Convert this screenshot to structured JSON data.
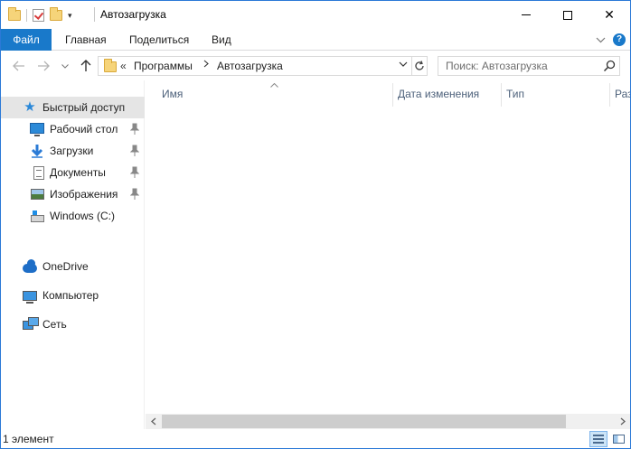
{
  "window": {
    "title": "Автозагрузка",
    "minimize_glyph": "",
    "maximize_glyph": "",
    "close_glyph": "✕"
  },
  "ribbon": {
    "tabs": [
      {
        "label": "Файл"
      },
      {
        "label": "Главная"
      },
      {
        "label": "Поделиться"
      },
      {
        "label": "Вид"
      }
    ],
    "help_glyph": "?"
  },
  "navigation": {
    "overflow_glyph": "«",
    "breadcrumbs": [
      "Программы",
      "Автозагрузка"
    ]
  },
  "search": {
    "placeholder": "Поиск: Автозагрузка"
  },
  "sidebar": {
    "quick_access": {
      "label": "Быстрый доступ",
      "icon": "star-icon"
    },
    "pinned": [
      {
        "label": "Рабочий стол",
        "icon": "desktop-icon",
        "pinned": true
      },
      {
        "label": "Загрузки",
        "icon": "download-icon",
        "pinned": true
      },
      {
        "label": "Документы",
        "icon": "documents-icon",
        "pinned": true
      },
      {
        "label": "Изображения",
        "icon": "pictures-icon",
        "pinned": true
      },
      {
        "label": "Windows (C:)",
        "icon": "drive-icon",
        "pinned": false
      }
    ],
    "locations": [
      {
        "label": "OneDrive",
        "icon": "onedrive-icon"
      },
      {
        "label": "Компьютер",
        "icon": "computer-icon"
      },
      {
        "label": "Сеть",
        "icon": "network-icon"
      }
    ]
  },
  "file_list": {
    "columns": [
      {
        "label": "Имя",
        "sorted": true
      },
      {
        "label": "Дата изменения"
      },
      {
        "label": "Тип"
      },
      {
        "label": "Раз"
      }
    ],
    "items": []
  },
  "status_bar": {
    "text": "1 элемент"
  },
  "colors": {
    "accent": "#1979ca",
    "selection": "#e5e5e5",
    "header_text": "#4c607a",
    "border": "#2b79d7"
  }
}
